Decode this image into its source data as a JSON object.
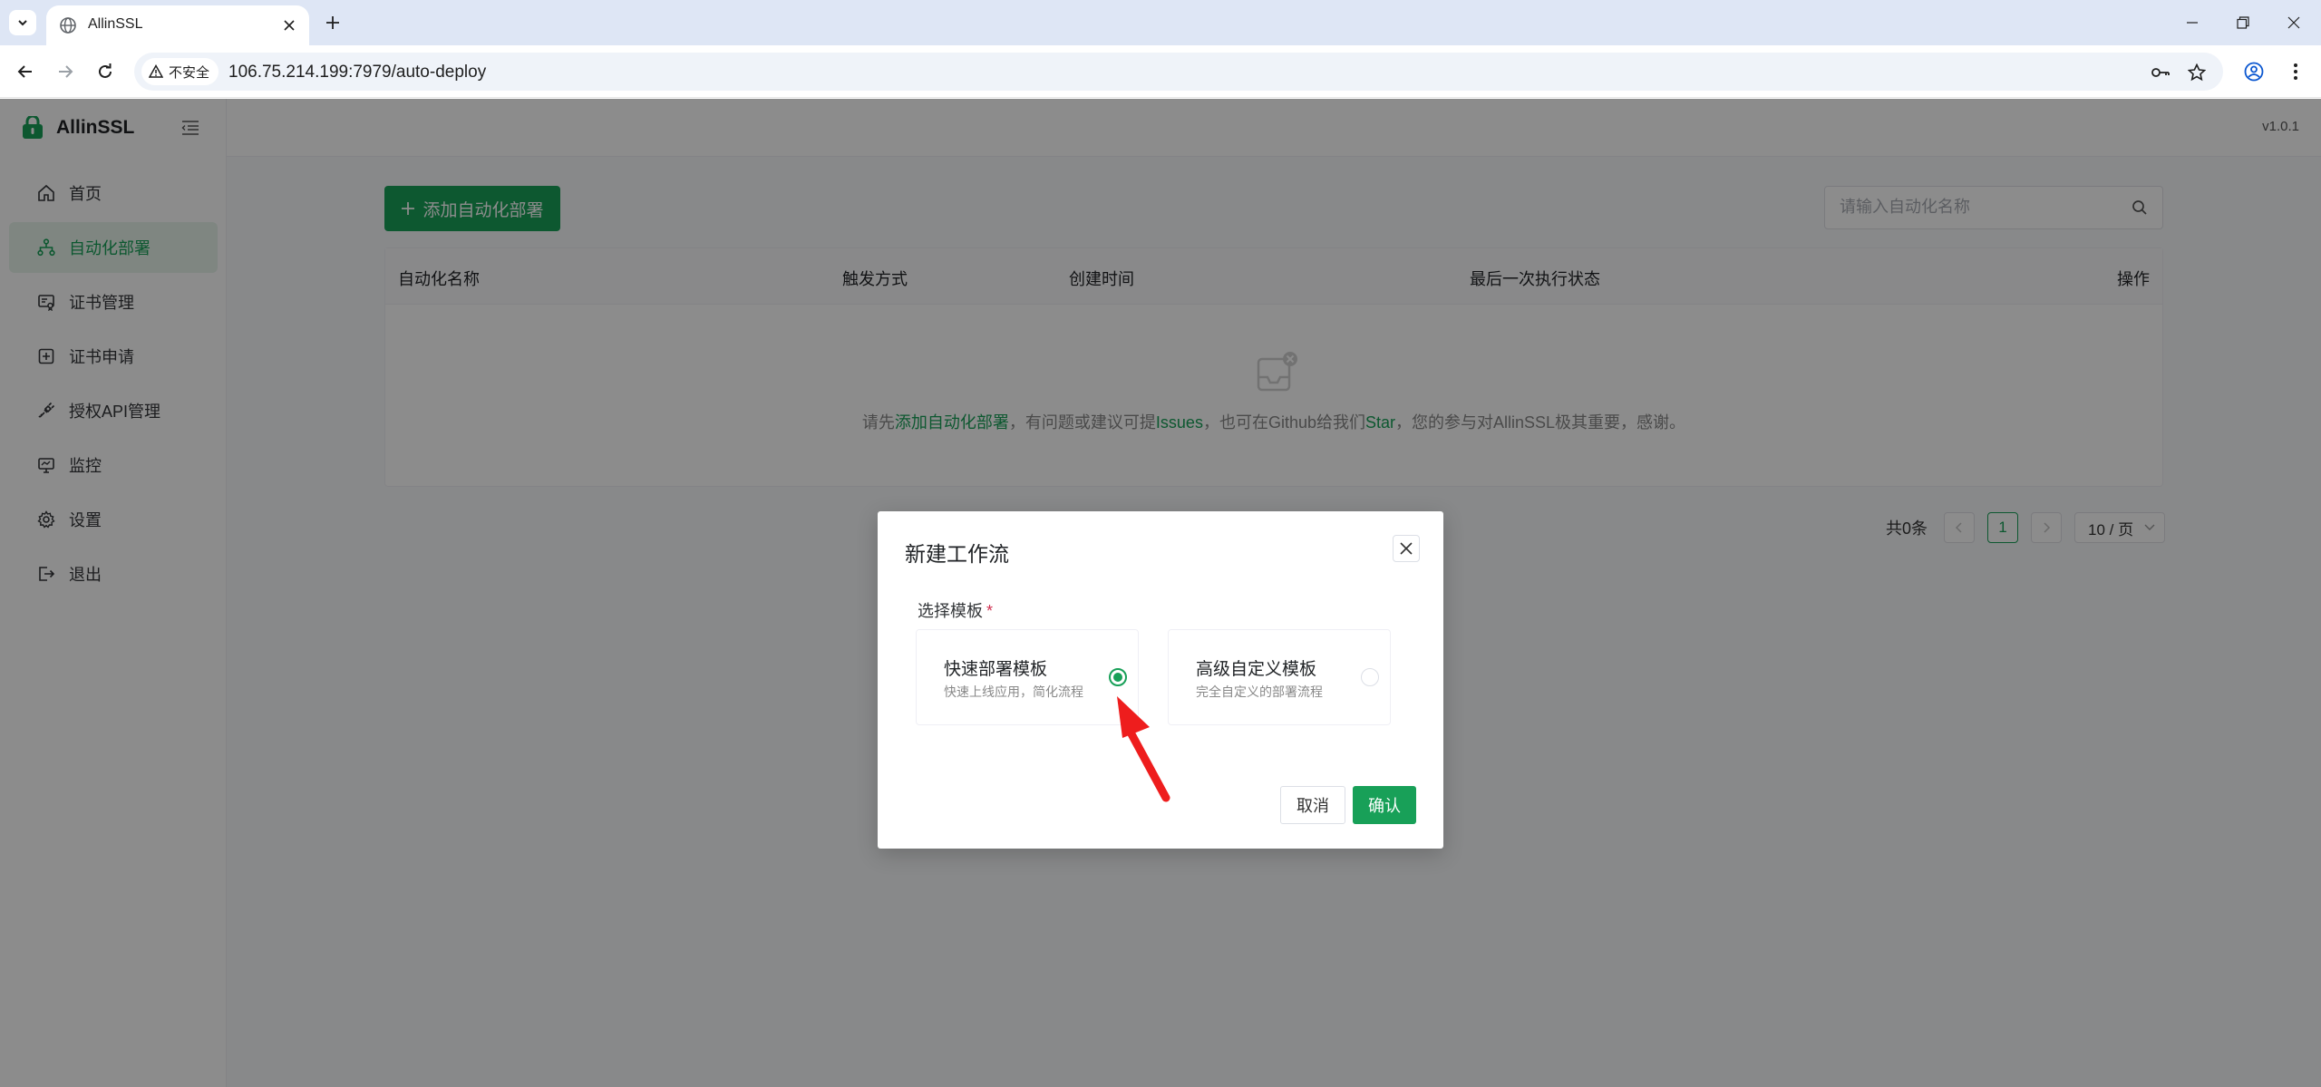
{
  "browser": {
    "tab_title": "AllinSSL",
    "security_label": "不安全",
    "url": "106.75.214.199:7979/auto-deploy"
  },
  "app": {
    "brand": "AllinSSL",
    "version": "v1.0.1",
    "accent": "#18a058"
  },
  "sidebar": {
    "items": [
      {
        "label": "首页",
        "icon": "home-icon",
        "active": false
      },
      {
        "label": "自动化部署",
        "icon": "workflow-icon",
        "active": true
      },
      {
        "label": "证书管理",
        "icon": "certificate-icon",
        "active": false
      },
      {
        "label": "证书申请",
        "icon": "add-square-icon",
        "active": false
      },
      {
        "label": "授权API管理",
        "icon": "key-plug-icon",
        "active": false
      },
      {
        "label": "监控",
        "icon": "monitor-icon",
        "active": false
      },
      {
        "label": "设置",
        "icon": "gear-icon",
        "active": false
      },
      {
        "label": "退出",
        "icon": "logout-icon",
        "active": false
      }
    ]
  },
  "main": {
    "add_button": "添加自动化部署",
    "search_placeholder": "请输入自动化名称",
    "table": {
      "columns": [
        "自动化名称",
        "触发方式",
        "创建时间",
        "最后一次执行状态",
        "操作"
      ],
      "rows": [],
      "empty": {
        "t1": "请先",
        "link1": "添加自动化部署",
        "t2": "，有问题或建议可提",
        "link2": "Issues",
        "t3": "，也可在Github给我们",
        "link3": "Star",
        "t4": "，您的参与对AllinSSL极其重要，感谢。"
      }
    },
    "pagination": {
      "total": "共0条",
      "current_page": "1",
      "page_size": "10 / 页"
    }
  },
  "modal": {
    "title": "新建工作流",
    "field_label": "选择模板",
    "required_mark": "*",
    "options": [
      {
        "title": "快速部署模板",
        "desc": "快速上线应用，简化流程",
        "selected": true
      },
      {
        "title": "高级自定义模板",
        "desc": "完全自定义的部署流程",
        "selected": false
      }
    ],
    "cancel": "取消",
    "confirm": "确认"
  }
}
